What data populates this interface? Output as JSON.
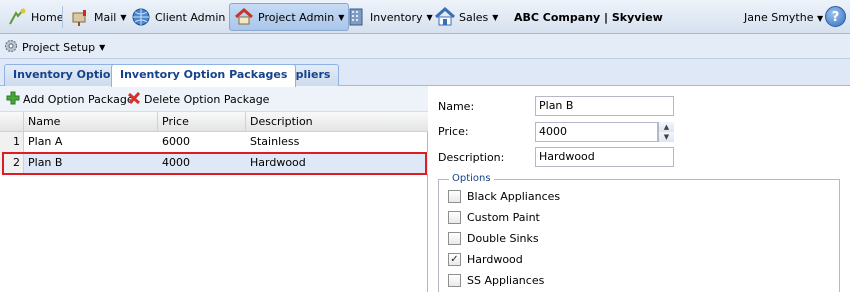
{
  "topnav": {
    "home": "Home",
    "mail": "Mail",
    "client_admin": "Client Admin",
    "project_admin": "Project Admin",
    "inventory": "Inventory",
    "sales": "Sales",
    "company": "ABC Company | Skyview",
    "user": "Jane Smythe",
    "help": "?"
  },
  "subnav": {
    "project_setup": "Project Setup"
  },
  "tabs": [
    "Inventory Options",
    "Inventory Option Packages",
    "Suppliers"
  ],
  "toolbar": {
    "add": "Add Option Package",
    "delete": "Delete Option Package"
  },
  "grid": {
    "columns": [
      "Name",
      "Price",
      "Description"
    ],
    "rows": [
      {
        "num": "1",
        "name": "Plan A",
        "price": "6000",
        "description": "Stainless"
      },
      {
        "num": "2",
        "name": "Plan B",
        "price": "4000",
        "description": "Hardwood"
      }
    ]
  },
  "form": {
    "name_label": "Name:",
    "name_value": "Plan B",
    "price_label": "Price:",
    "price_value": "4000",
    "desc_label": "Description:",
    "desc_value": "Hardwood",
    "options_legend": "Options",
    "options": [
      {
        "label": "Black Appliances",
        "checked": false
      },
      {
        "label": "Custom Paint",
        "checked": false
      },
      {
        "label": "Double Sinks",
        "checked": false
      },
      {
        "label": "Hardwood",
        "checked": true
      },
      {
        "label": "SS Appliances",
        "checked": false
      }
    ]
  },
  "colors": {
    "highlight": "#e01b24",
    "tab_text": "#15428b",
    "selected_row": "#dfe8f6"
  }
}
